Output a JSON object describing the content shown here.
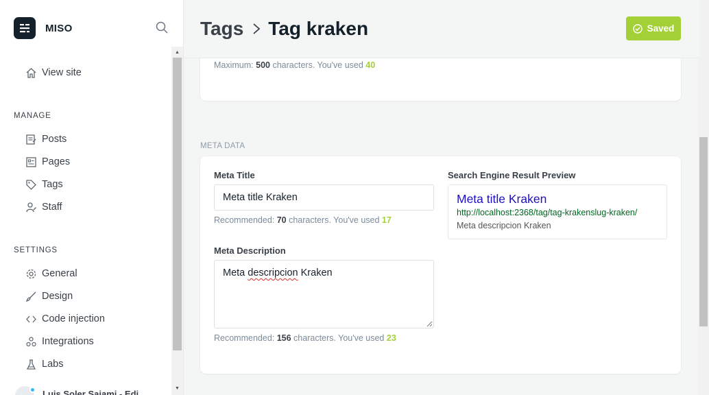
{
  "brand": {
    "name": "MISO"
  },
  "sidebar": {
    "view_site": "View site",
    "manage_label": "MANAGE",
    "manage_items": [
      {
        "label": "Posts",
        "icon": "posts-icon"
      },
      {
        "label": "Pages",
        "icon": "pages-icon"
      },
      {
        "label": "Tags",
        "icon": "tag-icon"
      },
      {
        "label": "Staff",
        "icon": "staff-icon"
      }
    ],
    "settings_label": "SETTINGS",
    "settings_items": [
      {
        "label": "General",
        "icon": "gear-icon"
      },
      {
        "label": "Design",
        "icon": "brush-icon"
      },
      {
        "label": "Code injection",
        "icon": "code-icon"
      },
      {
        "label": "Integrations",
        "icon": "integrations-icon"
      },
      {
        "label": "Labs",
        "icon": "flask-icon"
      }
    ],
    "user_name": "Luis Soler Sajami - Edi"
  },
  "header": {
    "parent": "Tags",
    "current": "Tag kraken",
    "saved_label": "Saved"
  },
  "description_hint": {
    "prefix": "Maximum: ",
    "max": "500",
    "mid": " characters. You've used ",
    "used": "40"
  },
  "meta": {
    "section_title": "META DATA",
    "title_label": "Meta Title",
    "title_value": "Meta title Kraken",
    "title_hint": {
      "prefix": "Recommended: ",
      "max": "70",
      "mid": " characters. You've used ",
      "used": "17"
    },
    "desc_label": "Meta Description",
    "desc_value_1": "Meta ",
    "desc_value_2": "descripcion",
    "desc_value_3": " Kraken",
    "desc_hint": {
      "prefix": "Recommended: ",
      "max": "156",
      "mid": " characters. You've used ",
      "used": "23"
    }
  },
  "serp": {
    "label": "Search Engine Result Preview",
    "title": "Meta title Kraken",
    "url": "http://localhost:2368/tag/tag-krakenslug-kraken/",
    "description": "Meta descripcion Kraken"
  },
  "colors": {
    "accent": "#a4d037",
    "serp_title": "#1e0fbe",
    "serp_url": "#006621"
  }
}
